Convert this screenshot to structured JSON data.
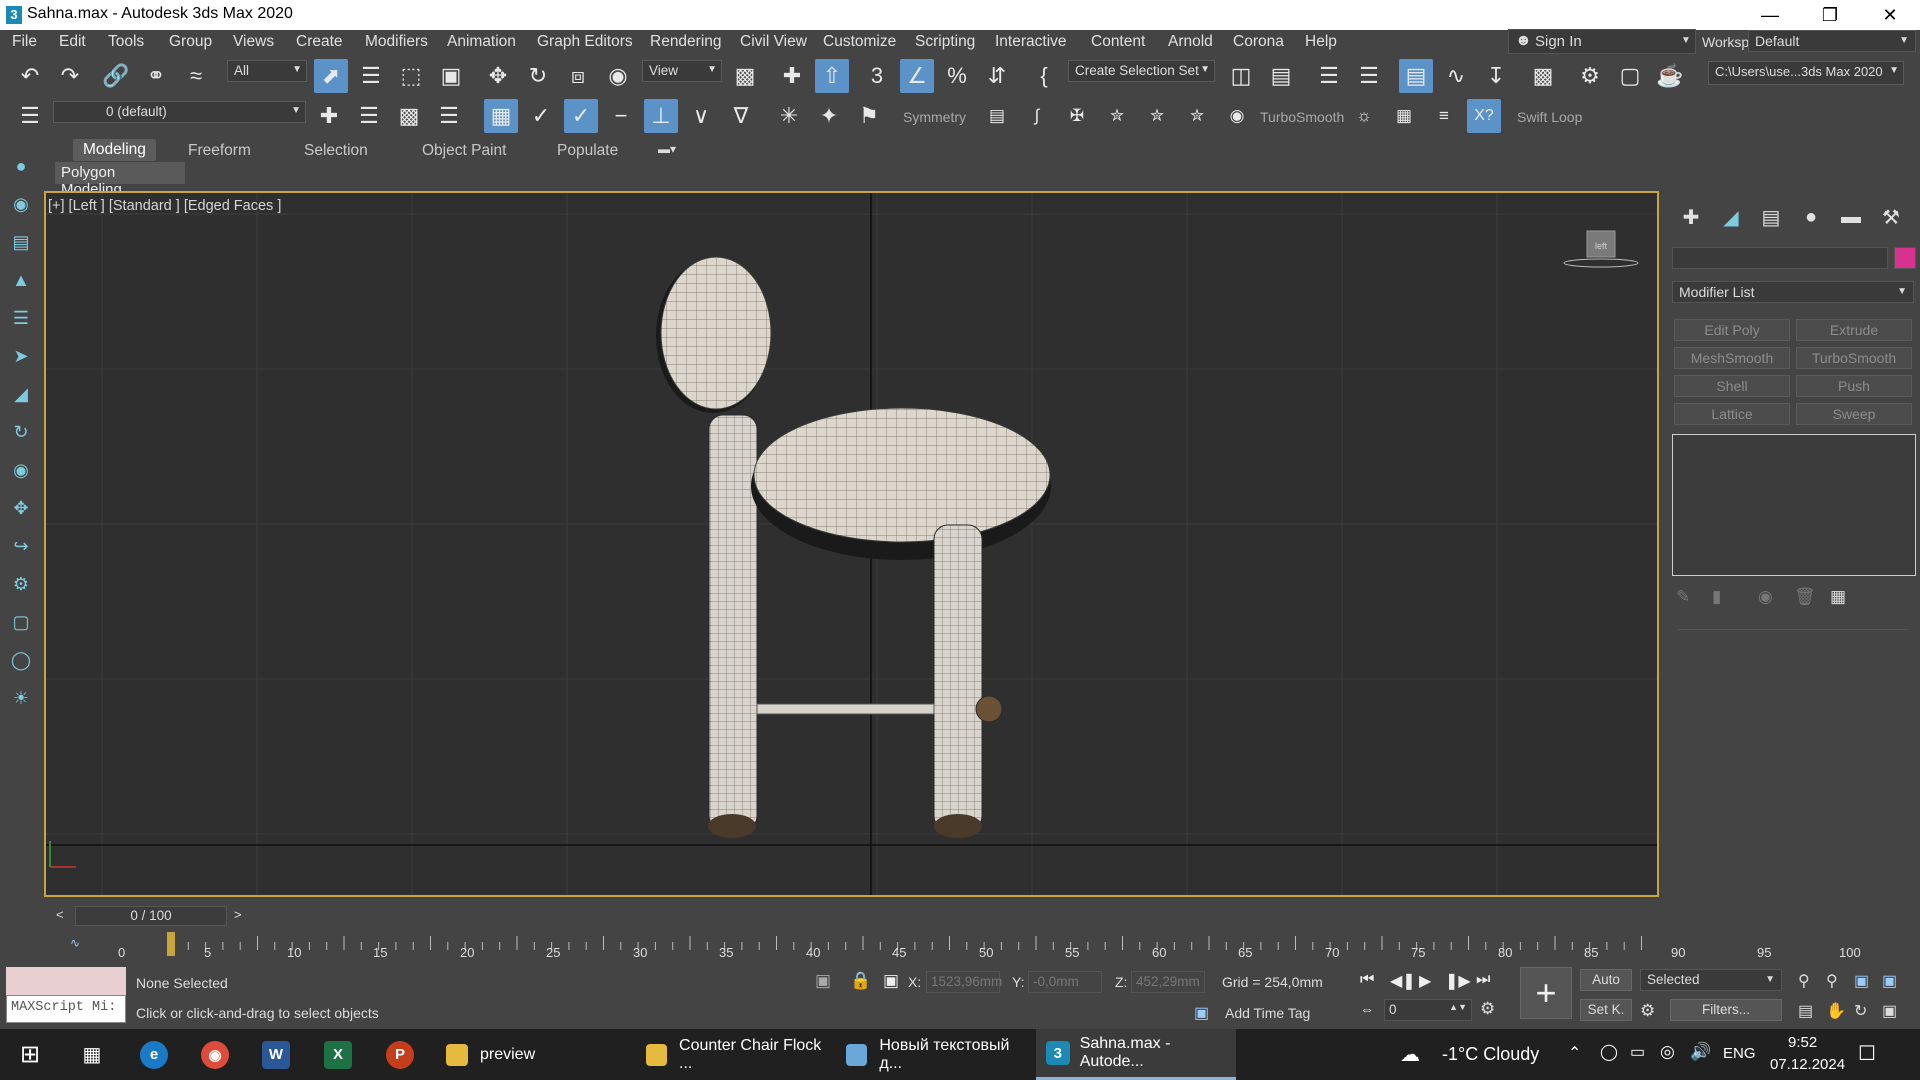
{
  "window": {
    "title": "Sahna.max - Autodesk 3ds Max 2020",
    "app_icon": "3"
  },
  "menu": [
    "File",
    "Edit",
    "Tools",
    "Group",
    "Views",
    "Create",
    "Modifiers",
    "Animation",
    "Graph Editors",
    "Rendering",
    "Civil View",
    "Customize",
    "Scripting",
    "Interactive",
    "Content",
    "Arnold",
    "Corona",
    "Help"
  ],
  "signin": "Sign In",
  "workspaces": {
    "label": "Workspaces:",
    "value": "Default"
  },
  "toolbar1": {
    "filter_value": "All",
    "refcoord_value": "View",
    "selection_set": "Create Selection Set",
    "path_value": "C:\\Users\\use...3ds Max 2020"
  },
  "toolbar2": {
    "layer_value": "0 (default)",
    "symmetry_label": "Symmetry",
    "turbosmooth_label": "TurboSmooth",
    "swiftloop_label": "Swift Loop"
  },
  "ribbon": {
    "tabs": [
      "Modeling",
      "Freeform",
      "Selection",
      "Object Paint",
      "Populate"
    ],
    "active_tab": "Modeling",
    "panel_label": "Polygon Modeling"
  },
  "viewport": {
    "label": "[+] [Left ] [Standard ] [Edged Faces ]",
    "cube_label": "left"
  },
  "command_panel": {
    "modifier_list": "Modifier List",
    "modifier_buttons": [
      "Edit Poly",
      "Extrude",
      "MeshSmooth",
      "TurboSmooth",
      "Shell",
      "Push",
      "Lattice",
      "Sweep"
    ],
    "color_swatch": "#d8328f"
  },
  "timeline": {
    "slider_text": "0 / 100",
    "ticks": [
      "0",
      "5",
      "10",
      "15",
      "20",
      "25",
      "30",
      "35",
      "40",
      "45",
      "50",
      "55",
      "60",
      "65",
      "70",
      "75",
      "80",
      "85",
      "90",
      "95",
      "100"
    ]
  },
  "status": {
    "maxscript": "MAXScript Mi:",
    "selection": "None Selected",
    "prompt": "Click or click-and-drag to select objects",
    "x_label": "X:",
    "x_value": "1523,96mm",
    "y_label": "Y:",
    "y_value": "-0,0mm",
    "z_label": "Z:",
    "z_value": "452,29mm",
    "grid": "Grid = 254,0mm",
    "add_time_tag": "Add Time Tag",
    "auto": "Auto",
    "set_key": "Set K.",
    "key_filter": "Selected",
    "filters": "Filters...",
    "frame": "0"
  },
  "taskbar": {
    "apps": [
      {
        "label": "preview",
        "icon": "folder-icon"
      },
      {
        "label": "Counter Chair Flock ...",
        "icon": "folder-icon"
      },
      {
        "label": "Новый текстовый д...",
        "icon": "notepad-icon"
      },
      {
        "label": "Sahna.max - Autode...",
        "icon": "3dsmax-icon"
      }
    ],
    "weather": "-1°C  Cloudy",
    "lang": "ENG",
    "time": "9:52",
    "date": "07.12.2024"
  }
}
